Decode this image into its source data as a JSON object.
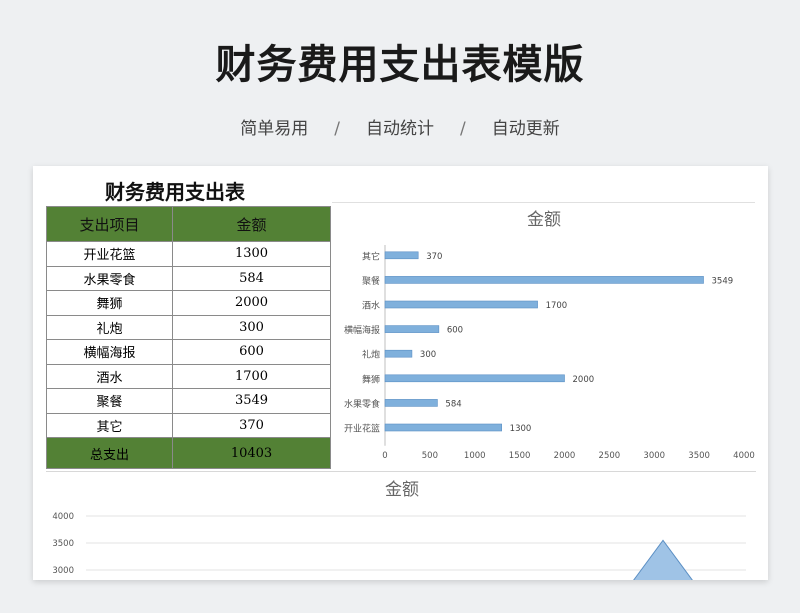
{
  "header": {
    "title": "财务费用支出表模版",
    "features": [
      "简单易用",
      "自动统计",
      "自动更新"
    ],
    "separator": "/"
  },
  "sheet": {
    "title": "财务费用支出表",
    "columns": [
      "支出项目",
      "金额"
    ],
    "rows": [
      {
        "item": "开业花篮",
        "amount": "1300"
      },
      {
        "item": "水果零食",
        "amount": "584"
      },
      {
        "item": "舞狮",
        "amount": "2000"
      },
      {
        "item": "礼炮",
        "amount": "300"
      },
      {
        "item": "横幅海报",
        "amount": "600"
      },
      {
        "item": "酒水",
        "amount": "1700"
      },
      {
        "item": "聚餐",
        "amount": "3549"
      },
      {
        "item": "其它",
        "amount": "370"
      }
    ],
    "total": {
      "label": "总支出",
      "amount": "10403"
    }
  },
  "colors": {
    "header_green": "#538135",
    "bar_blue": "#7fb0dc",
    "bar_stroke": "#5b8fc4"
  },
  "chart_data": [
    {
      "type": "bar",
      "orientation": "horizontal",
      "title": "金额",
      "categories": [
        "其它",
        "聚餐",
        "酒水",
        "横幅海报",
        "礼炮",
        "舞狮",
        "水果零食",
        "开业花篮"
      ],
      "values": [
        370,
        3549,
        1700,
        600,
        300,
        2000,
        584,
        1300
      ],
      "xlim": [
        0,
        4000
      ],
      "xticks": [
        0,
        500,
        1000,
        1500,
        2000,
        2500,
        3000,
        3500,
        4000
      ],
      "data_labels": true,
      "grid": false
    },
    {
      "type": "area",
      "title": "金额",
      "visible_yticks": [
        "4000",
        "3500",
        "3000"
      ],
      "visible_peak_value": 3549,
      "grid": true,
      "partially_visible": true
    }
  ]
}
